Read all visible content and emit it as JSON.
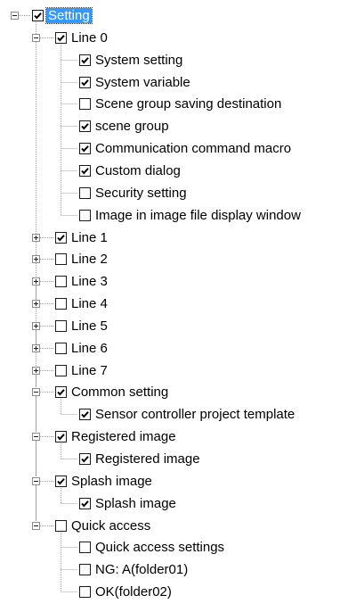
{
  "tree": {
    "nodes": [
      {
        "label": "Setting",
        "checked": true,
        "depth": 0,
        "expander": "minus",
        "selected": true
      },
      {
        "label": "Line 0",
        "checked": true,
        "depth": 1,
        "expander": "minus"
      },
      {
        "label": "System setting",
        "checked": true,
        "depth": 2
      },
      {
        "label": "System variable",
        "checked": true,
        "depth": 2
      },
      {
        "label": "Scene group saving destination",
        "checked": false,
        "depth": 2
      },
      {
        "label": "scene group",
        "checked": true,
        "depth": 2
      },
      {
        "label": "Communication command macro",
        "checked": true,
        "depth": 2
      },
      {
        "label": "Custom dialog",
        "checked": true,
        "depth": 2
      },
      {
        "label": "Security setting",
        "checked": false,
        "depth": 2
      },
      {
        "label": "Image in image file display window",
        "checked": false,
        "depth": 2
      },
      {
        "label": "Line 1",
        "checked": true,
        "depth": 1,
        "expander": "plus"
      },
      {
        "label": "Line 2",
        "checked": false,
        "depth": 1,
        "expander": "plus"
      },
      {
        "label": "Line 3",
        "checked": false,
        "depth": 1,
        "expander": "plus"
      },
      {
        "label": "Line 4",
        "checked": false,
        "depth": 1,
        "expander": "plus"
      },
      {
        "label": "Line 5",
        "checked": false,
        "depth": 1,
        "expander": "plus"
      },
      {
        "label": "Line 6",
        "checked": false,
        "depth": 1,
        "expander": "plus"
      },
      {
        "label": "Line 7",
        "checked": false,
        "depth": 1,
        "expander": "plus"
      },
      {
        "label": "Common setting",
        "checked": true,
        "depth": 1,
        "expander": "minus"
      },
      {
        "label": "Sensor controller project template",
        "checked": true,
        "depth": 2
      },
      {
        "label": "Registered image",
        "checked": true,
        "depth": 1,
        "expander": "minus"
      },
      {
        "label": "Registered image",
        "checked": true,
        "depth": 2
      },
      {
        "label": "Splash image",
        "checked": true,
        "depth": 1,
        "expander": "minus"
      },
      {
        "label": "Splash image",
        "checked": true,
        "depth": 2
      },
      {
        "label": "Quick access",
        "checked": false,
        "depth": 1,
        "expander": "minus"
      },
      {
        "label": "Quick access settings",
        "checked": false,
        "depth": 2
      },
      {
        "label": "NG: A(folder01)",
        "checked": false,
        "depth": 2
      },
      {
        "label": "OK(folder02)",
        "checked": false,
        "depth": 2
      }
    ]
  },
  "colors": {
    "selection": "#3399ff",
    "selection_text": "#ffffff",
    "connector": "#a0a0a0"
  }
}
